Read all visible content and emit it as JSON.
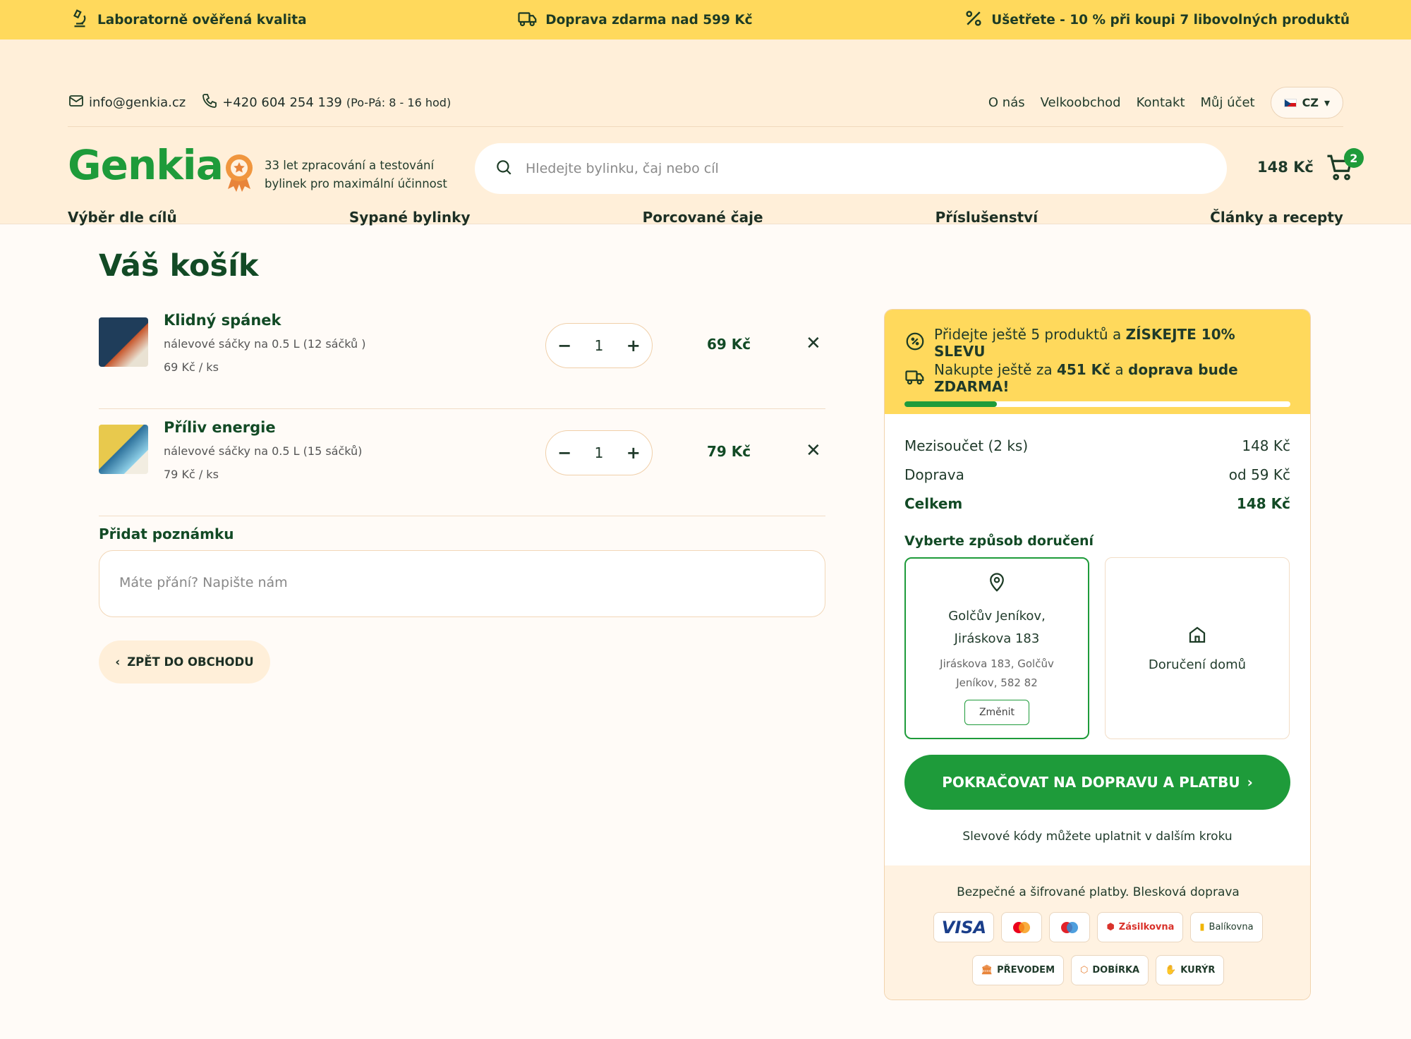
{
  "promo": {
    "quality": "Laboratorně ověřená kvalita",
    "shipping": "Doprava zdarma nad 599 Kč",
    "discount": "Ušetřete - 10 % při koupi 7 libovolných produktů"
  },
  "utility": {
    "email": "info@genkia.cz",
    "phone": "+420 604 254 139",
    "hours": "(Po-Pá: 8 - 16 hod)",
    "links": [
      "O nás",
      "Velkoobchod",
      "Kontakt",
      "Můj účet"
    ],
    "lang": "CZ"
  },
  "brand": {
    "logo": "Genkia",
    "badge_line1": "33 let zpracování a testování",
    "badge_line2": "bylinek pro maximální účinnost"
  },
  "search": {
    "placeholder": "Hledejte bylinku, čaj nebo cíl"
  },
  "minicart": {
    "total": "148 Kč",
    "count": "2"
  },
  "nav": [
    "Výběr dle cílů",
    "Sypané bylinky",
    "Porcované čaje",
    "Příslušenství",
    "Články a recepty"
  ],
  "cart": {
    "title": "Váš košík",
    "items": [
      {
        "name": "Klidný spánek",
        "variant": "nálevové sáčky na 0.5 L (12 sáčků )",
        "unit_price": "69 Kč / ks",
        "qty": "1",
        "price": "69 Kč",
        "image_color": "#1f3d5a"
      },
      {
        "name": "Příliv energie",
        "variant": "nálevové sáčky na 0.5 L (15 sáčků)",
        "unit_price": "79 Kč / ks",
        "qty": "1",
        "price": "79 Kč",
        "image_color": "#e8c94d"
      }
    ],
    "note_label": "Přidat poznámku",
    "note_placeholder": "Máte přání? Napište nám",
    "back_label": "ZPĚT DO OBCHODU"
  },
  "summary": {
    "promo_prefix": "Přidejte ještě 5 produktů a",
    "promo_highlight": "ZÍSKEJTE 10% SLEVU",
    "ship_prefix": "Nakupte ještě za",
    "ship_amount": "451 Kč",
    "ship_mid": "a",
    "ship_suffix": "doprava bude ZDARMA!",
    "progress": 0.24,
    "subtotal_label": "Mezisoučet (2 ks)",
    "subtotal_value": "148 Kč",
    "shipping_label": "Doprava",
    "shipping_value": "od 59 Kč",
    "total_label": "Celkem",
    "total_value": "148 Kč",
    "delivery_title": "Vyberte způsob doručení",
    "pickup_line1": "Golčův Jeníkov,",
    "pickup_line2": "Jiráskova 183",
    "pickup_sub1": "Jiráskova 183, Golčův",
    "pickup_sub2": "Jeníkov, 582 82",
    "change_label": "Změnit",
    "home_label": "Doručení domů",
    "continue_label": "POKRAČOVAT NA DOPRAVU A PLATBU",
    "discount_note": "Slevové kódy můžete uplatnit v dalším kroku",
    "secure_text": "Bezpečné a šifrované platby. Blesková doprava",
    "payments_row1": [
      "VISA",
      "",
      "",
      "Zásilkovna",
      "Balíkovna"
    ],
    "payments_row2": [
      "PŘEVODEM",
      "DOBÍRKA",
      "KURÝR"
    ]
  },
  "colors": {
    "accent": "#1e9b3a",
    "promo": "#ffd95c",
    "header": "#ffefd9",
    "text_dark": "#124a25"
  }
}
